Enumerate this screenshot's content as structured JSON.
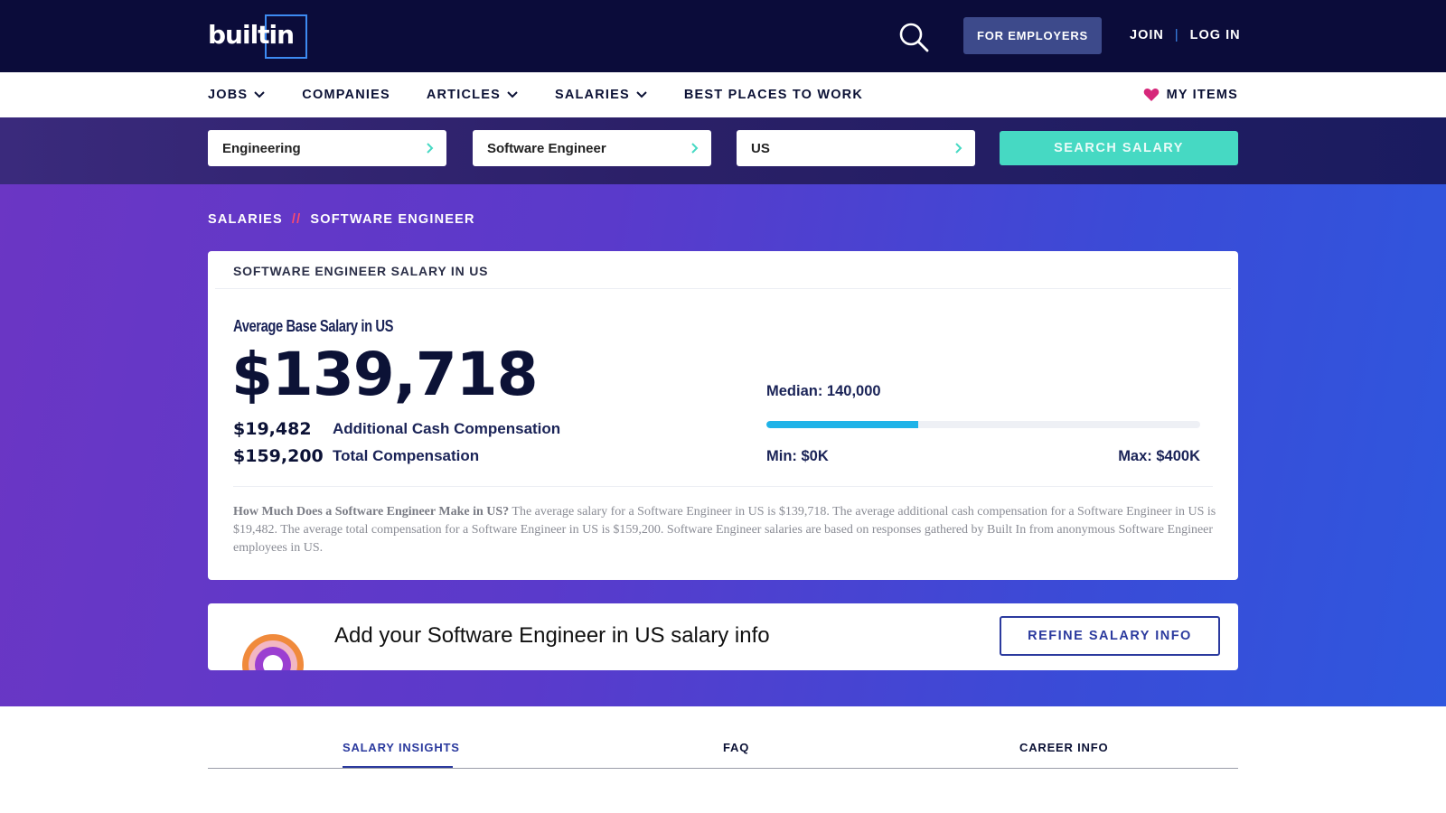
{
  "brand": {
    "logo_text": "builtin",
    "colors": {
      "navy": "#0b0c3a",
      "accent_blue": "#3d8bf2",
      "teal": "#46d9c3",
      "heart": "#d6277a",
      "cta_blue": "#2b3a9e",
      "bar_fill": "#1fb3e8"
    }
  },
  "topbar": {
    "search_icon": "search-icon",
    "employers_label": "FOR EMPLOYERS",
    "join_label": "JOIN",
    "separator": "|",
    "login_label": "LOG IN"
  },
  "nav": {
    "items": [
      {
        "label": "JOBS",
        "has_dropdown": true
      },
      {
        "label": "COMPANIES",
        "has_dropdown": false
      },
      {
        "label": "ARTICLES",
        "has_dropdown": true
      },
      {
        "label": "SALARIES",
        "has_dropdown": true
      },
      {
        "label": "BEST PLACES TO WORK",
        "has_dropdown": false
      }
    ],
    "my_items_label": "MY ITEMS",
    "my_items_icon": "heart-icon"
  },
  "search": {
    "category_value": "Engineering",
    "role_value": "Software Engineer",
    "location_value": "US",
    "button_label": "SEARCH SALARY"
  },
  "breadcrumb": {
    "root": "SALARIES",
    "separator": "//",
    "current": "SOFTWARE ENGINEER"
  },
  "salary_card": {
    "header": "SOFTWARE ENGINEER SALARY IN US",
    "avg_label": "Average Base Salary in US",
    "avg_salary": "$139,718",
    "additional_amount": "$19,482",
    "additional_label": "Additional Cash Compensation",
    "total_amount": "$159,200",
    "total_label": "Total Compensation",
    "median_label": "Median: 140,000",
    "min_label": "Min: $0K",
    "max_label": "Max: $400K",
    "range_fill_fraction": 0.35,
    "description_lead": "How Much Does a Software Engineer Make in US?",
    "description_body": " The average salary for a Software Engineer in US is $139,718. The average additional cash compensation for a Software Engineer in US is $19,482. The average total compensation for a Software Engineer in US is $159,200. Software Engineer salaries are based on responses gathered by Built In from anonymous Software Engineer employees in US."
  },
  "info_card": {
    "text": "Add your Software Engineer in US salary info",
    "button_label": "REFINE SALARY INFO",
    "illustration_icon": "rainbow-icon"
  },
  "tabs": {
    "items": [
      "SALARY INSIGHTS",
      "FAQ",
      "CAREER INFO"
    ],
    "active_index": 0
  }
}
